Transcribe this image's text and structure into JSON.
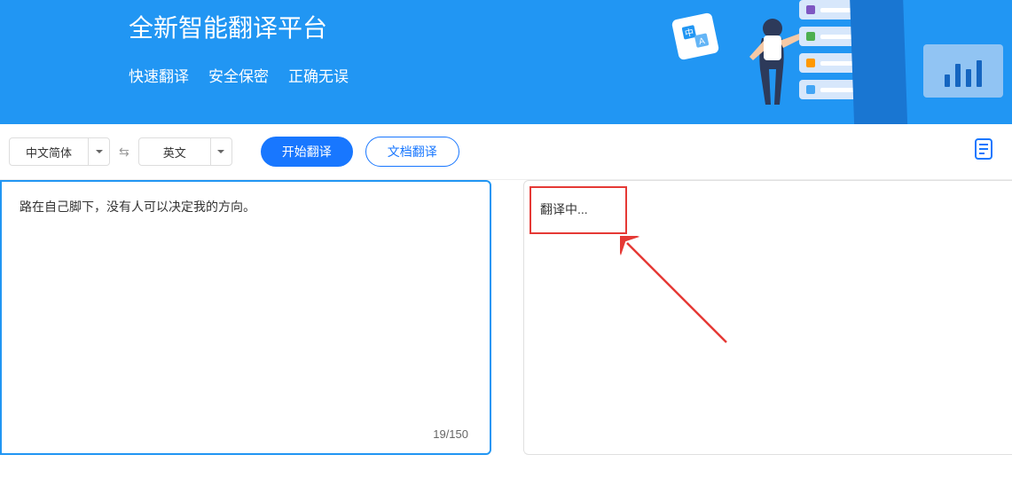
{
  "hero": {
    "title": "全新智能翻译平台",
    "sub1": "快速翻译",
    "sub2": "安全保密",
    "sub3": "正确无误",
    "badge": "中A"
  },
  "toolbar": {
    "source_lang": "中文简体",
    "target_lang": "英文",
    "start_label": "开始翻译",
    "doc_label": "文档翻译"
  },
  "source": {
    "text": "路在自己脚下，没有人可以决定我的方向。",
    "count": "19/150"
  },
  "target": {
    "status": "翻译中..."
  }
}
